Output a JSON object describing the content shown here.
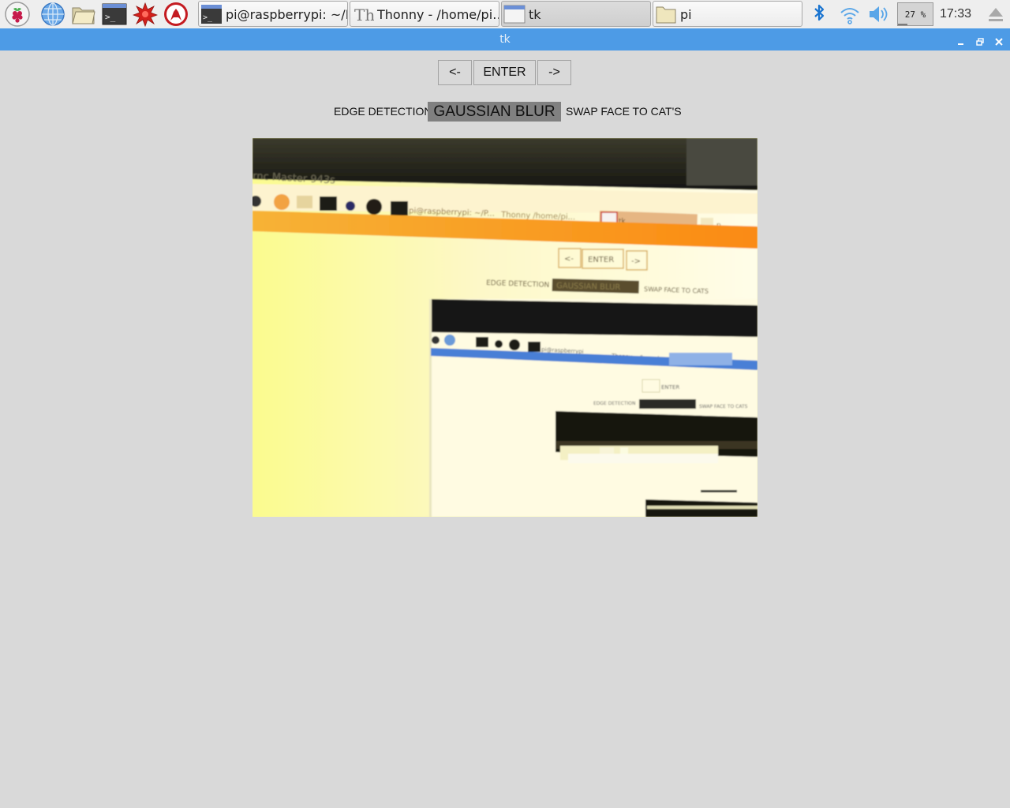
{
  "taskbar": {
    "launchers": [
      "raspberry-menu-icon",
      "web-browser-icon",
      "file-manager-icon",
      "terminal-icon",
      "mathematica-icon",
      "wolfram-icon"
    ],
    "tasks": [
      {
        "icon": "terminal-icon",
        "label": "pi@raspberrypi: ~/P…",
        "active": false
      },
      {
        "icon": "thonny-icon",
        "label": "Thonny  -  /home/pi…",
        "active": false
      },
      {
        "icon": "tk-window-icon",
        "label": "tk",
        "active": true
      },
      {
        "icon": "folder-icon",
        "label": "pi",
        "active": false
      }
    ],
    "tray": {
      "bluetooth_icon": "bluetooth-icon",
      "wifi_icon": "wifi-icon",
      "volume_icon": "volume-icon",
      "cpu_usage": "27 %",
      "clock": "17:33",
      "eject_icon": "eject-icon"
    }
  },
  "window": {
    "title": "tk",
    "controls": [
      "minimize-icon",
      "maximize-icon",
      "close-icon"
    ]
  },
  "app": {
    "prev_label": "<-",
    "enter_label": "ENTER",
    "next_label": "->",
    "modes": [
      "EDGE DETECTION",
      "GAUSSIAN BLUR",
      "SWAP FACE TO CAT'S"
    ],
    "selected_mode": "GAUSSIAN BLUR"
  },
  "camera_feed": {
    "nested_text": {
      "monitor_brand": "rnc Master 943s",
      "taskbar_task1": "pi@raspberrypi: ~/P...",
      "taskbar_task2": "Thonny  /home/pi...",
      "taskbar_task3": "tk",
      "taskbar_task4": "p",
      "prev": "<-",
      "enter": "ENTER",
      "next": "->",
      "mode1": "EDGE DETECTION",
      "mode2": "GAUSSIAN BLUR",
      "mode3": "SWAP FACE TO CATS",
      "nested_task": "pi@raspberrypi",
      "nested_thonny": "Thonny",
      "nested_home": "/home/p",
      "nested_enter": "ENTER",
      "nested_mode1": "EDGE DETECTION",
      "nested_mode3": "SWAP FACE TO CATS"
    }
  }
}
